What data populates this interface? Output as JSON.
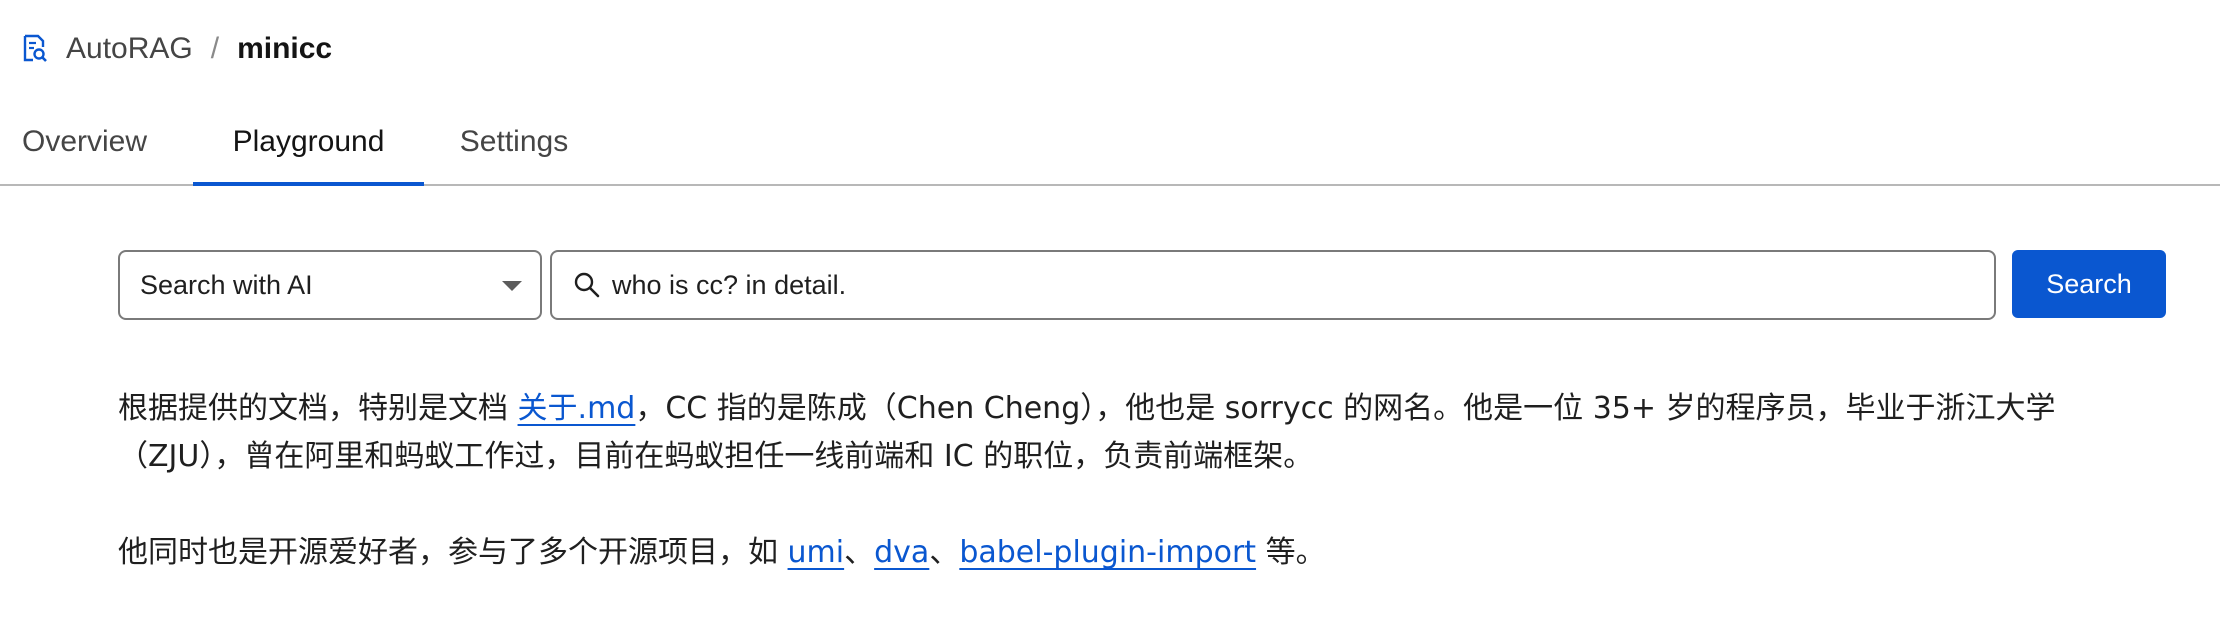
{
  "breadcrumb": {
    "icon": "document-search-icon",
    "root": "AutoRAG",
    "separator": "/",
    "current": "minicc"
  },
  "tabs": [
    {
      "label": "Overview",
      "active": false
    },
    {
      "label": "Playground",
      "active": true
    },
    {
      "label": "Settings",
      "active": false
    }
  ],
  "search": {
    "mode": "Search with AI",
    "query": "who is cc? in detail.",
    "button_label": "Search",
    "icon": "search-icon"
  },
  "answer": {
    "p1": {
      "t1": "根据提供的文档，特别是文档 ",
      "link": "关于.md",
      "t2": "，CC 指的是陈成（Chen Cheng），他也是 sorrycc 的网名。他是一位 35+ 岁的程序员，毕业于浙江大学（ZJU），曾在阿里和蚂蚁工作过，目前在蚂蚁担任一线前端和 IC 的职位，负责前端框架。"
    },
    "p2": {
      "t1": "他同时也是开源爱好者，参与了多个开源项目，如 ",
      "link1": "umi",
      "sep1": "、",
      "link2": "dva",
      "sep2": "、",
      "link3": "babel-plugin-import",
      "t2": " 等。"
    }
  },
  "colors": {
    "accent": "#0a57d0",
    "border": "#7a7a7a",
    "text": "#1f1f1f"
  }
}
